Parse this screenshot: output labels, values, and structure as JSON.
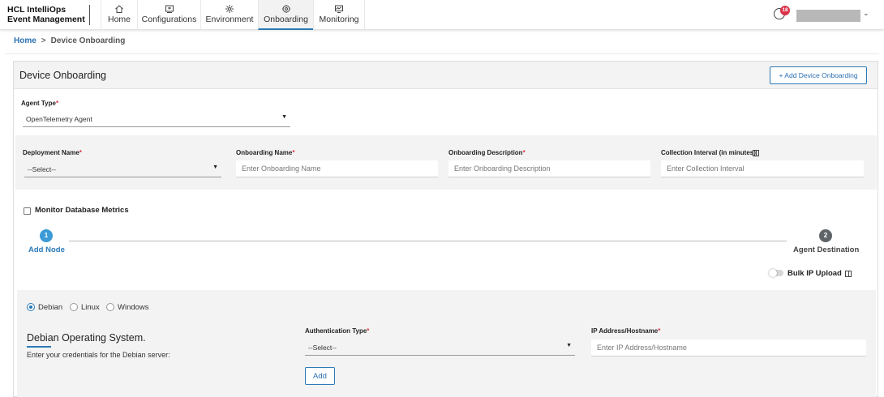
{
  "app": {
    "brand_line1": "HCL IntelliOps",
    "brand_line2": "Event Management"
  },
  "nav": {
    "tabs": [
      {
        "label": "Home",
        "icon": "home-icon"
      },
      {
        "label": "Configurations",
        "icon": "configurations-icon"
      },
      {
        "label": "Environment",
        "icon": "environment-icon"
      },
      {
        "label": "Onboarding",
        "icon": "onboarding-icon",
        "active": true
      },
      {
        "label": "Monitoring",
        "icon": "monitoring-icon"
      }
    ],
    "notification_count": "18"
  },
  "breadcrumb": {
    "home": "Home",
    "separator": ">",
    "current": "Device Onboarding"
  },
  "card": {
    "title": "Device Onboarding",
    "add_button": "+ Add Device Onboarding"
  },
  "form": {
    "agent_type": {
      "label": "Agent Type",
      "value": "OpenTelemetry Agent"
    },
    "deployment_name": {
      "label": "Deployment Name",
      "value": "--Select--"
    },
    "onboarding_name": {
      "label": "Onboarding Name",
      "placeholder": "Enter Onboarding Name"
    },
    "onboarding_description": {
      "label": "Onboarding Description",
      "placeholder": "Enter Onboarding Description"
    },
    "collection_interval": {
      "label": "Collection Interval (in minutes)",
      "placeholder": "Enter Collection Interval"
    },
    "required_mark": "*",
    "monitor_db_label": "Monitor Database Metrics",
    "monitor_db_checked": false
  },
  "stepper": {
    "steps": [
      {
        "number": "1",
        "label": "Add Node",
        "active": true
      },
      {
        "number": "2",
        "label": "Agent Destination",
        "active": false
      }
    ]
  },
  "bulk_upload": {
    "label": "Bulk IP Upload",
    "enabled": false
  },
  "os": {
    "options": [
      "Debian",
      "Linux",
      "Windows"
    ],
    "selected": "Debian",
    "title": "Debian Operating System.",
    "subtitle": "Enter your credentials for the Debian server:",
    "auth_type": {
      "label": "Authentication Type",
      "value": "--Select--"
    },
    "ip_address": {
      "label": "IP Address/Hostname",
      "placeholder": "Enter IP Address/Hostname"
    },
    "add_button": "Add"
  },
  "colors": {
    "accent": "#2a7ab8",
    "link": "#2a6fb0",
    "required": "#d9334a",
    "step_inactive": "#5f6469",
    "panel": "#f3f3f3"
  }
}
